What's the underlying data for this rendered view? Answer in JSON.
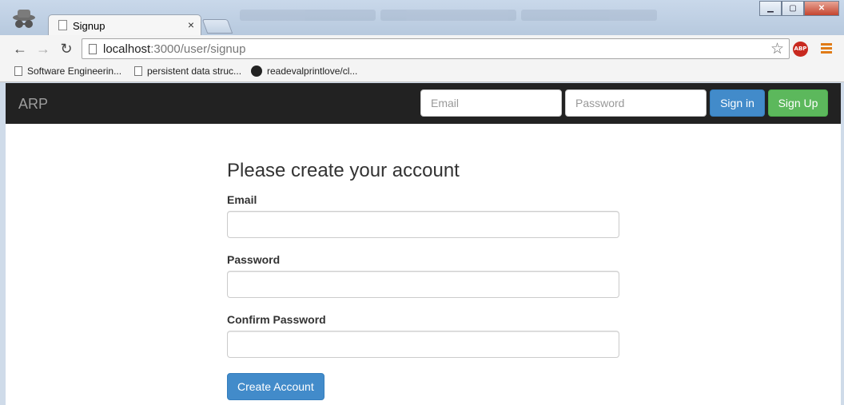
{
  "browser": {
    "tab_title": "Signup",
    "tab_close": "×",
    "url_host": "localhost",
    "url_path": ":3000/user/signup",
    "abp_label": "ABP",
    "bookmarks": [
      {
        "label": "Software Engineerin...",
        "icon": "page-icon"
      },
      {
        "label": "persistent data struc...",
        "icon": "page-icon"
      },
      {
        "label": "readevalprintlove/cl...",
        "icon": "github-icon"
      }
    ]
  },
  "navbar": {
    "brand": "ARP",
    "email_placeholder": "Email",
    "password_placeholder": "Password",
    "signin_label": "Sign in",
    "signup_label": "Sign Up"
  },
  "form": {
    "heading": "Please create your account",
    "email_label": "Email",
    "password_label": "Password",
    "confirm_label": "Confirm Password",
    "submit_label": "Create Account"
  },
  "colors": {
    "navbar_bg": "#222222",
    "primary": "#428bca",
    "success": "#5cb85c"
  }
}
